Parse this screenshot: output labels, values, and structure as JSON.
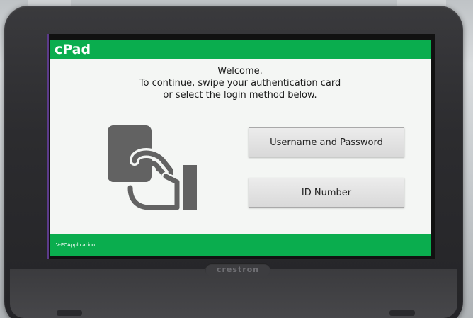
{
  "header": {
    "title": "cPad"
  },
  "welcome": {
    "line1": "Welcome.",
    "line2": "To continue, swipe your authentication card",
    "line3": "or select the login method below."
  },
  "login_methods": [
    {
      "label": "Username and Password"
    },
    {
      "label": "ID Number"
    }
  ],
  "footer": {
    "app_name": "V-PCApplication"
  },
  "device": {
    "brand_text": "crestron"
  },
  "colors": {
    "accent_green": "#0aad4e",
    "icon_gray": "#626262",
    "screen_bg": "#f4f6f4",
    "bezel": "#2c2c2f"
  },
  "icons": {
    "card_swipe": "hand-swiping-card-icon"
  }
}
